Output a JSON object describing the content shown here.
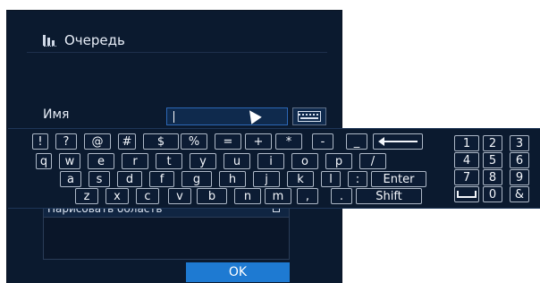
{
  "dialog": {
    "title": "Очередь",
    "name_label": "Имя",
    "name_value": "",
    "list_item": "Нарисовать область",
    "ok_label": "OK"
  },
  "keyboard": {
    "row1": [
      "!",
      "?",
      "@",
      "#",
      "$",
      "%",
      "=",
      "+",
      "*",
      "-",
      "_"
    ],
    "row2": [
      "q",
      "w",
      "e",
      "r",
      "t",
      "y",
      "u",
      "i",
      "o",
      "p",
      "/"
    ],
    "row3": [
      "a",
      "s",
      "d",
      "f",
      "g",
      "h",
      "j",
      "k",
      "l",
      ":"
    ],
    "enter_label": "Enter",
    "row4": [
      "z",
      "x",
      "c",
      "v",
      "b",
      "n",
      "m",
      ",",
      "."
    ],
    "shift_label": "Shift",
    "numpad": [
      "1",
      "2",
      "3",
      "4",
      "5",
      "6",
      "7",
      "8",
      "9",
      "0",
      "&"
    ]
  },
  "colors": {
    "dialog_bg": "#0b1a2f",
    "accent": "#1e7ad2"
  },
  "icons": {
    "title": "queue-icon",
    "keyboard_toggle": "keyboard-icon",
    "backspace": "backspace-icon",
    "space": "space-icon",
    "delete": "trash-icon"
  }
}
